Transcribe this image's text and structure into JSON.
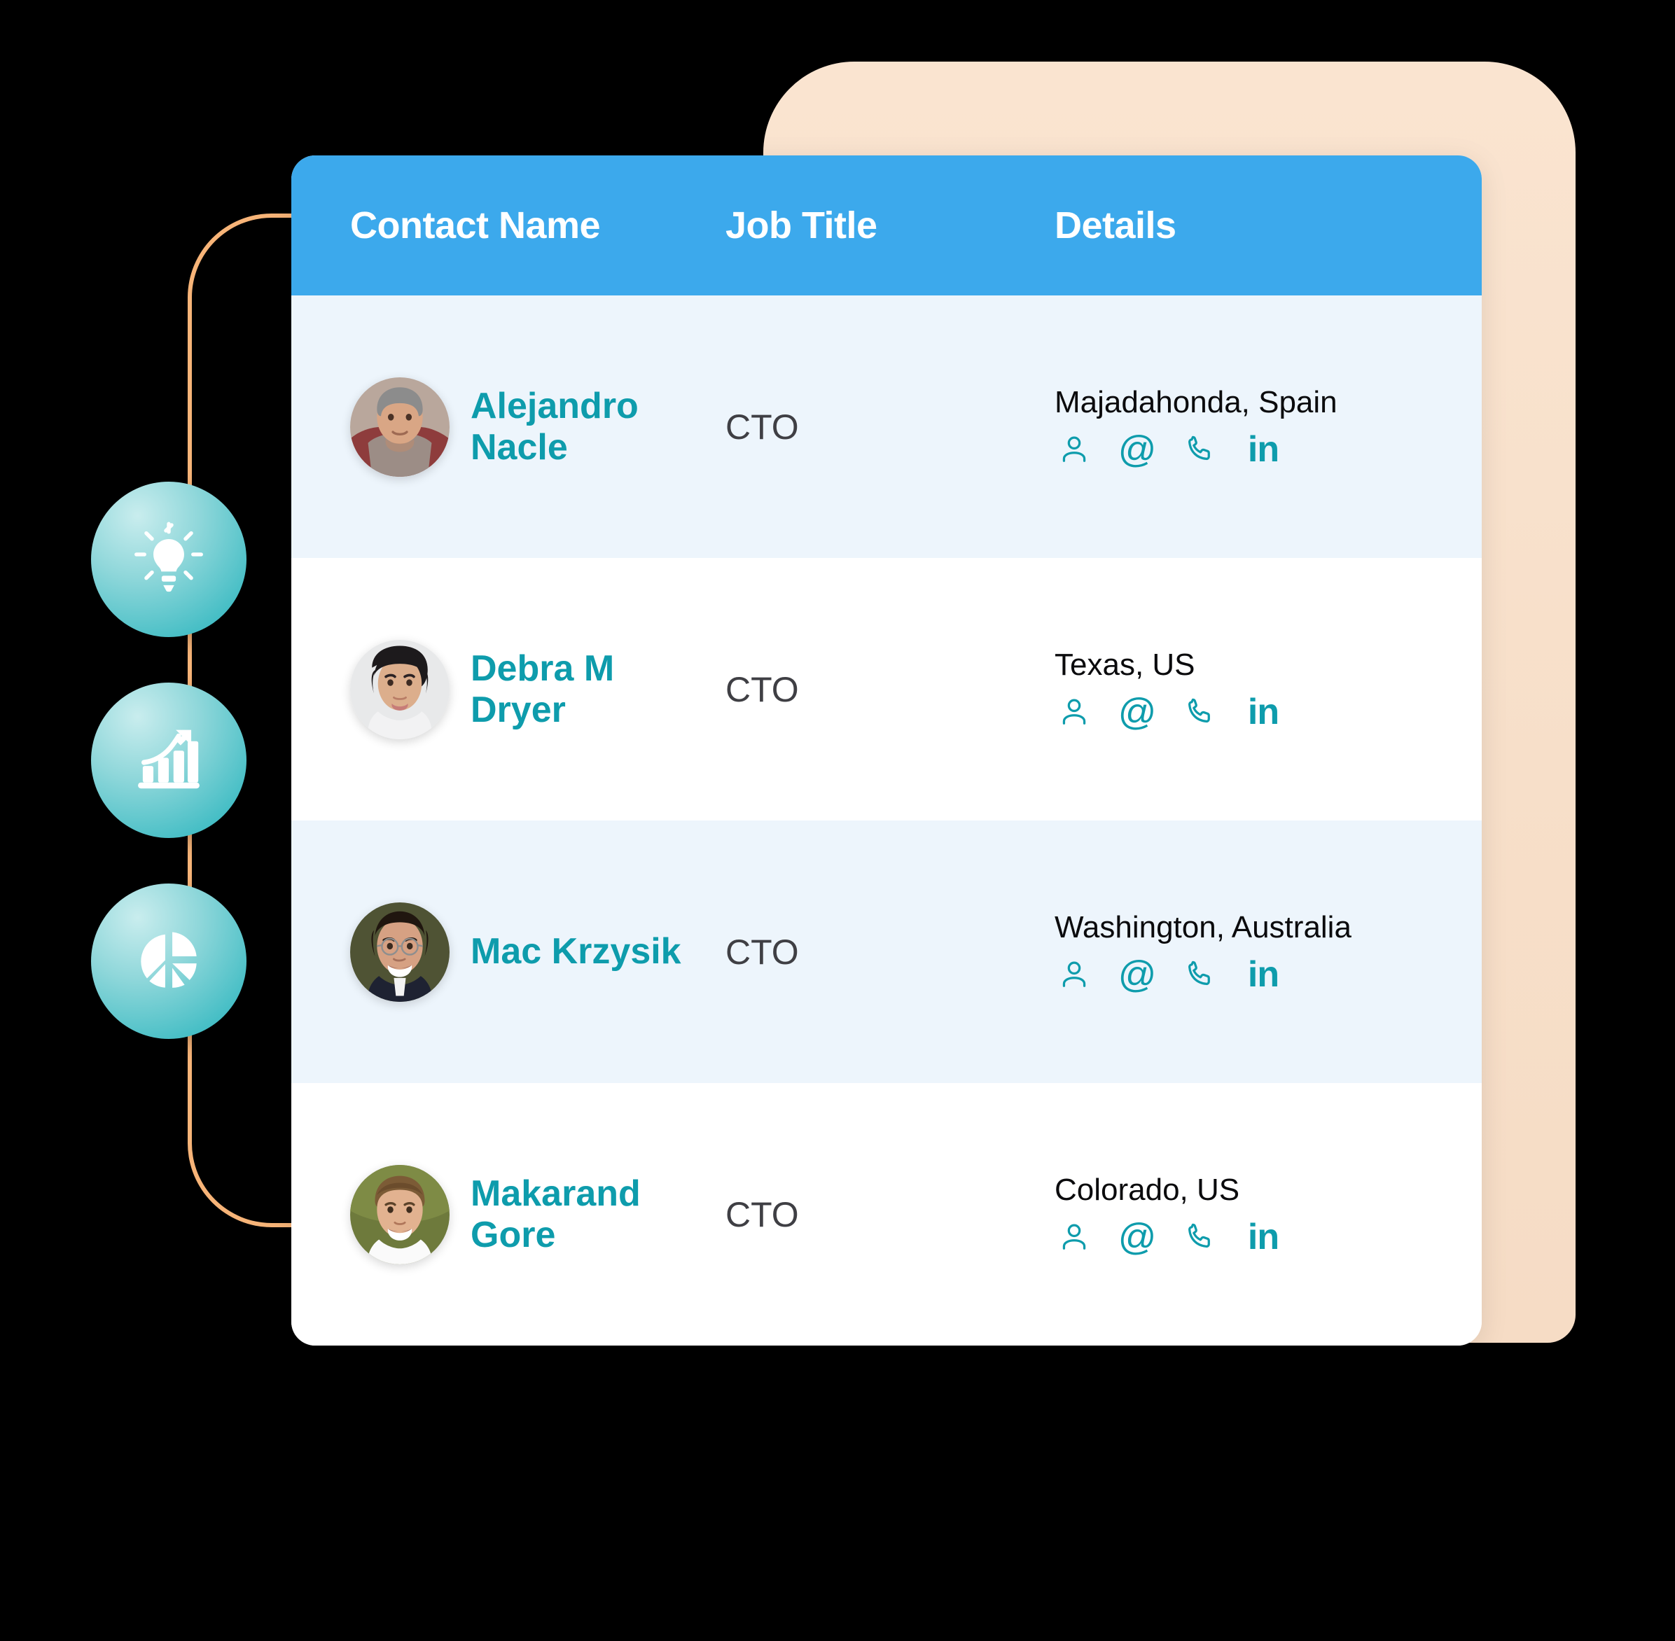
{
  "card": {
    "header": {
      "columns": [
        {
          "key": "name",
          "label": "Contact Name"
        },
        {
          "key": "job",
          "label": "Job Title"
        },
        {
          "key": "det",
          "label": "Details"
        }
      ]
    },
    "rows": [
      {
        "name_line1": "Alejandro",
        "name_line2": "Nacle",
        "job_title": "CTO",
        "location": "Majadahonda, Spain",
        "actions": [
          "contact-icon",
          "email-icon",
          "phone-icon",
          "linkedin-icon"
        ]
      },
      {
        "name_line1": "Debra M",
        "name_line2": "Dryer",
        "job_title": "CTO",
        "location": "Texas, US",
        "actions": [
          "contact-icon",
          "email-icon",
          "phone-icon",
          "linkedin-icon"
        ]
      },
      {
        "name_line1": "Mac Krzysik",
        "name_line2": "",
        "job_title": "CTO",
        "location": "Washington, Australia",
        "actions": [
          "contact-icon",
          "email-icon",
          "phone-icon",
          "linkedin-icon"
        ]
      },
      {
        "name_line1": "Makarand",
        "name_line2": "Gore",
        "job_title": "CTO",
        "location": "Colorado, US",
        "actions": [
          "contact-icon",
          "email-icon",
          "phone-icon",
          "linkedin-icon"
        ]
      }
    ]
  },
  "feature_badges": [
    {
      "icon": "lightbulb-icon"
    },
    {
      "icon": "bar-chart-growth-icon"
    },
    {
      "icon": "pie-chart-icon"
    }
  ],
  "icon_glyphs": {
    "email": "@",
    "linkedin": "in"
  },
  "colors": {
    "header_blue": "#3CA9EC",
    "name_teal": "#0E9CAC",
    "icon_teal": "#0E9CAC",
    "row_alt": "#EDF5FC",
    "row_plain": "#FFFFFF",
    "peach_backdrop": "#F8E1CC",
    "connector_orange": "#F7B478",
    "job_title_gray": "#3F3F44",
    "badge_teal": "#2BB3BD",
    "page_background": "#000000"
  }
}
